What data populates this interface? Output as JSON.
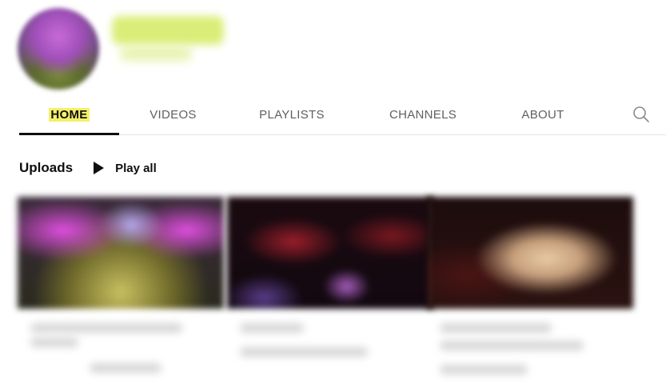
{
  "tabs": [
    {
      "label": "HOME",
      "active": true
    },
    {
      "label": "VIDEOS",
      "active": false
    },
    {
      "label": "PLAYLISTS",
      "active": false
    },
    {
      "label": "CHANNELS",
      "active": false
    },
    {
      "label": "ABOUT",
      "active": false
    }
  ],
  "search": {
    "icon": "search-icon"
  },
  "uploads": {
    "title": "Uploads",
    "play_all_label": "Play all",
    "play_icon": "play-icon"
  },
  "colors": {
    "active_tab_highlight": "#f3f06a",
    "channel_name_blur": "#d6ec6a",
    "text_primary": "#0f0f0f",
    "text_secondary": "#606060"
  }
}
